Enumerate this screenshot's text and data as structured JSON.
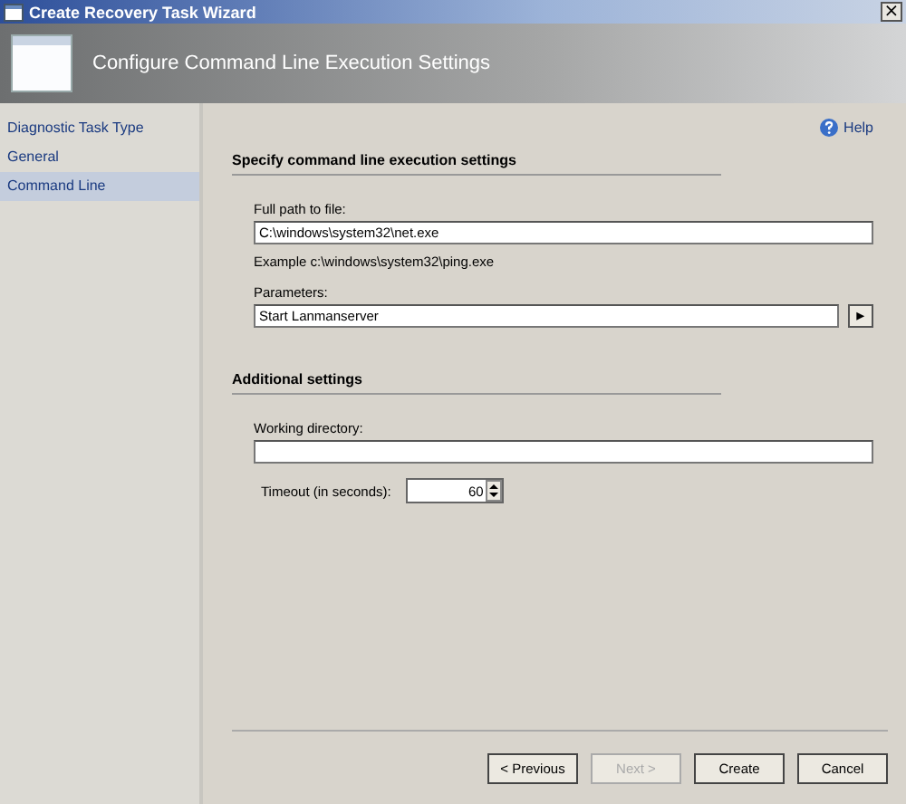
{
  "window": {
    "title": "Create Recovery Task Wizard",
    "close": "×"
  },
  "header": {
    "title": "Configure Command Line Execution Settings"
  },
  "sidebar": {
    "items": [
      {
        "label": "Diagnostic Task Type",
        "selected": false
      },
      {
        "label": "General",
        "selected": false
      },
      {
        "label": "Command Line",
        "selected": true
      }
    ]
  },
  "help": {
    "label": "Help"
  },
  "sections": [
    {
      "title": "Specify command line execution settings",
      "fields": [
        {
          "kind": "text",
          "label": "Full path to file:",
          "value": "C:\\windows\\system32\\net.exe",
          "hint": "Example c:\\windows\\system32\\ping.exe"
        },
        {
          "kind": "browse",
          "label": "Parameters:",
          "value": "Start Lanmanserver",
          "button": "▸"
        }
      ]
    },
    {
      "title": "Additional settings",
      "fields": [
        {
          "kind": "text",
          "label": "Working directory:"
        },
        {
          "kind": "spin",
          "label": "Timeout (in seconds):",
          "value": "60"
        }
      ]
    }
  ],
  "buttons": [
    {
      "label": "< Previous",
      "disabled": false
    },
    {
      "label": "Next >",
      "disabled": true
    },
    {
      "label": "Create",
      "disabled": false
    },
    {
      "label": "Cancel",
      "disabled": false
    }
  ]
}
